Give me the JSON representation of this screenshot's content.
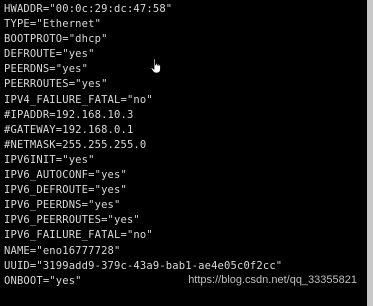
{
  "terminal": {
    "lines": [
      "HWADDR=\"00:0c:29:dc:47:58\"",
      "TYPE=\"Ethernet\"",
      "BOOTPROTO=\"dhcp\"",
      "DEFROUTE=\"yes\"",
      "PEERDNS=\"yes\"",
      "PEERROUTES=\"yes\"",
      "IPV4_FAILURE_FATAL=\"no\"",
      "#IPADDR=192.168.10.3",
      "#GATEWAY=192.168.0.1",
      "#NETMASK=255.255.255.0",
      "IPV6INIT=\"yes\"",
      "IPV6_AUTOCONF=\"yes\"",
      "IPV6_DEFROUTE=\"yes\"",
      "IPV6_PEERDNS=\"yes\"",
      "IPV6_PEERROUTES=\"yes\"",
      "IPV6_FAILURE_FATAL=\"no\"",
      "NAME=\"eno16777728\"",
      "UUID=\"3199add9-379c-43a9-bab1-ae4e05c0f2cc\"",
      "ONBOOT=\"yes\""
    ]
  },
  "watermark": "https://blog.csdn.net/qq_33355821",
  "colors": {
    "background": "#000000",
    "text": "#d9d9d9",
    "watermark": "#bfbfbf"
  },
  "cursor_icon": "hand-pointer-icon"
}
